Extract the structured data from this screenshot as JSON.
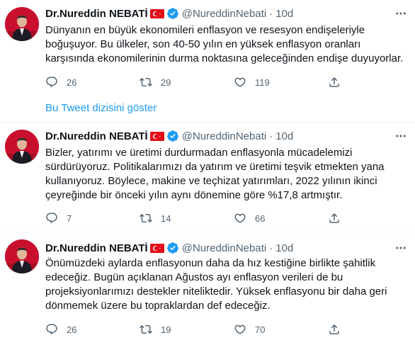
{
  "colors": {
    "accent": "#1d9bf0",
    "muted": "#536471",
    "text": "#0f1419",
    "flag": "#e30a17"
  },
  "thread_link": "Bu Tweet dizisini göster",
  "tweets": [
    {
      "name": "Dr.Nureddin NEBATİ",
      "handle": "@NureddinNebati",
      "dot": "·",
      "time": "10d",
      "text": "Dünyanın en büyük ekonomileri enflasyon ve resesyon endişeleriyle\nboğuşuyor. Bu ülkeler, son 40-50 yılın en yüksek enflasyon oranları\nkarşısında ekonomilerinin durma noktasına geleceğinden endişe duyuyorlar.",
      "replies": "26",
      "retweets": "29",
      "likes": "119"
    },
    {
      "name": "Dr.Nureddin NEBATİ",
      "handle": "@NureddinNebati",
      "dot": "·",
      "time": "10d",
      "text": "Bizler, yatırımı ve üretimi durdurmadan enflasyonla mücadelemizi\nsürdürüyoruz. Politikalarımızı da yatırım ve üretimi teşvik etmekten yana\nkullanıyoruz. Böylece, makine ve teçhizat yatırımları, 2022 yılının ikinci\nçeyreğinde bir önceki yılın aynı dönemine göre %17,8 artmıştır.",
      "replies": "7",
      "retweets": "14",
      "likes": "66"
    },
    {
      "name": "Dr.Nureddin NEBATİ",
      "handle": "@NureddinNebati",
      "dot": "·",
      "time": "10d",
      "text": "Önümüzdeki aylarda enflasyonun daha da hız kestiğine birlikte şahitlik\nedeceğiz. Bugün açıklanan Ağustos ayı enflasyon verileri de bu\nprojeksiyonlarımızı destekler niteliktedir. Yüksek enflasyonu bir daha geri\ndönmemek üzere bu topraklardan def edeceğiz.",
      "replies": "26",
      "retweets": "19",
      "likes": "70"
    }
  ]
}
